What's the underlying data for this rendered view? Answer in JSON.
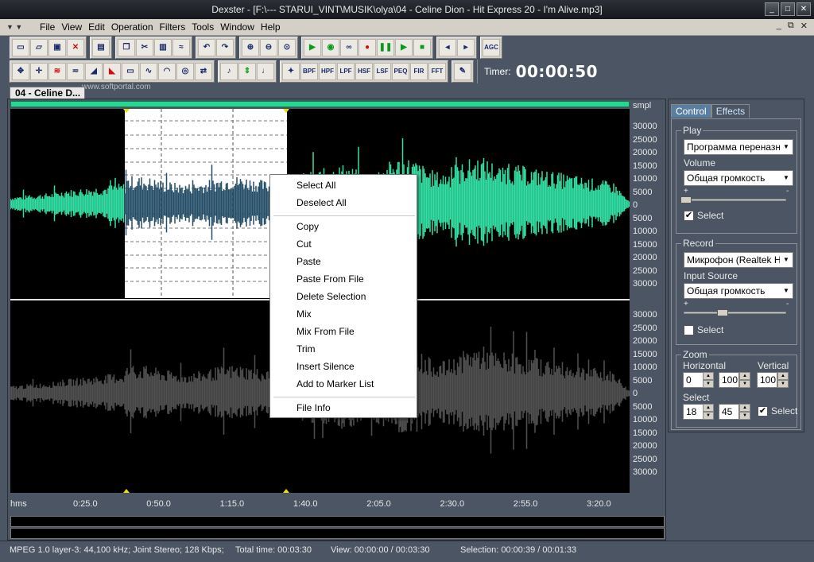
{
  "window": {
    "title": "Dexster - [F:\\---    STARUI_VINT\\MUSIK\\olya\\04 - Celine Dion - Hit Express 20 - I'm Alive.mp3]",
    "btn_min": "_",
    "btn_max": "□",
    "btn_close": "✕"
  },
  "menu": [
    "File",
    "View",
    "Edit",
    "Operation",
    "Filters",
    "Tools",
    "Window",
    "Help"
  ],
  "toolbar": {
    "filter_buttons": [
      "BPF",
      "HPF",
      "LPF",
      "HSF",
      "LSF",
      "PEQ",
      "FIR",
      "FFT"
    ],
    "agc_label": "AGC",
    "timer_label": "Timer:",
    "timer_value": "00:00:50"
  },
  "watermark": "www.softportal.com",
  "document_tab": "04 - Celine D...",
  "ruler": {
    "unit": "smpl",
    "top_ticks": [
      "30000",
      "25000",
      "20000",
      "15000",
      "10000",
      "5000",
      "0",
      "5000",
      "10000",
      "15000",
      "20000",
      "25000",
      "30000"
    ],
    "bottom_ticks": [
      "30000",
      "25000",
      "20000",
      "15000",
      "10000",
      "5000",
      "0",
      "5000",
      "10000",
      "15000",
      "20000",
      "25000",
      "30000"
    ]
  },
  "time_axis": {
    "unit": "hms",
    "labels": [
      "0:25.0",
      "0:50.0",
      "1:15.0",
      "1:40.0",
      "2:05.0",
      "2:30.0",
      "2:55.0",
      "3:20.0"
    ]
  },
  "context_menu": {
    "group1": [
      "Select All",
      "Deselect All"
    ],
    "group2": [
      "Copy",
      "Cut",
      "Paste",
      "Paste From File",
      "Delete Selection",
      "Mix",
      "Mix From File",
      "Trim",
      "Insert Silence",
      "Add to Marker List"
    ],
    "group3": [
      "File Info"
    ]
  },
  "panel": {
    "tabs": [
      "Control",
      "Effects"
    ],
    "play": {
      "title": "Play",
      "device": "Программа переназначения",
      "volume_label": "Volume",
      "volume_source": "Общая громкость",
      "plus": "+",
      "minus": "-",
      "select_label": "Select",
      "select_checked": "✔",
      "slider_level": 0.0
    },
    "record": {
      "title": "Record",
      "device": "Микрофон (Realtek High",
      "input_label": "Input Source",
      "input_source": "Общая громкость",
      "plus": "+",
      "minus": "-",
      "select_label": "Select",
      "slider_level": 0.4
    },
    "zoom": {
      "title": "Zoom",
      "horizontal_label": "Horizontal",
      "vertical_label": "Vertical",
      "h_min": "0",
      "h_val": "100",
      "v_val": "100",
      "select_label": "Select",
      "sel_start": "18",
      "sel_end": "45",
      "select_checkbox_label": "Select",
      "select_checked": "✔"
    }
  },
  "status": {
    "format": "MPEG 1.0 layer-3: 44,100 kHz; Joint Stereo; 128 Kbps;",
    "total_time": "Total time: 00:03:30",
    "view": "View: 00:00:00 / 00:03:30",
    "selection": "Selection: 00:00:39 / 00:01:33"
  },
  "colors": {
    "wave_active": "#32e0a4",
    "wave_selected": "#254e66",
    "wave_inactive": "#505050",
    "selection_bg": "#ffffff",
    "marker": "#e8e000"
  }
}
